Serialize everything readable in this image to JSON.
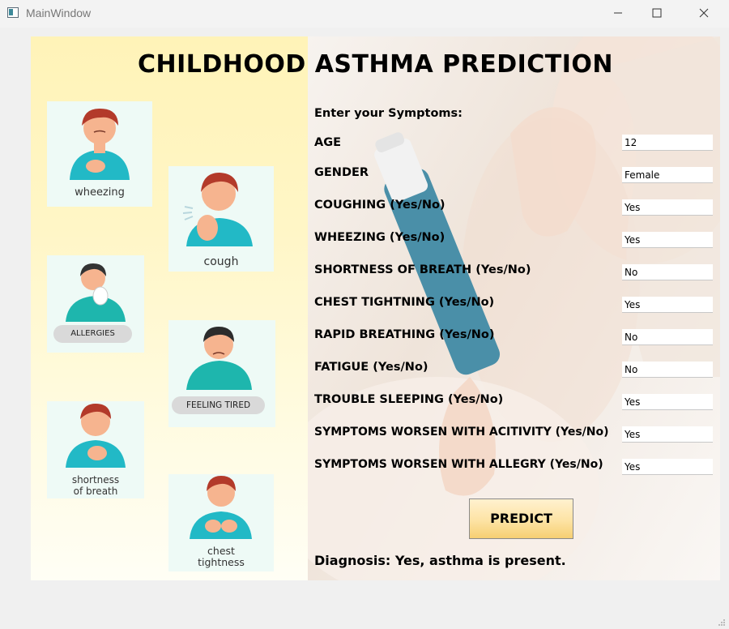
{
  "window": {
    "title": "MainWindow"
  },
  "app": {
    "title": "CHILDHOOD ASTHMA PREDICTION"
  },
  "illustrations": {
    "wheezing": "wheezing",
    "cough": "cough",
    "allergies": "ALLERGIES",
    "feeling_tired": "FEELING TIRED",
    "shortness_line1": "shortness",
    "shortness_line2": "of breath",
    "chest_line1": "chest",
    "chest_line2": "tightness"
  },
  "form": {
    "heading": "Enter your Symptoms:",
    "fields": [
      {
        "label": "AGE",
        "value": "12"
      },
      {
        "label": "GENDER",
        "value": "Female"
      },
      {
        "label": "COUGHING (Yes/No)",
        "value": "Yes"
      },
      {
        "label": "WHEEZING (Yes/No)",
        "value": "Yes"
      },
      {
        "label": "SHORTNESS OF BREATH (Yes/No)",
        "value": "No"
      },
      {
        "label": "CHEST TIGHTNING (Yes/No)",
        "value": "Yes"
      },
      {
        "label": "RAPID BREATHING (Yes/No)",
        "value": "No"
      },
      {
        "label": "FATIGUE (Yes/No)",
        "value": "No"
      },
      {
        "label": "TROUBLE SLEEPING (Yes/No)",
        "value": "Yes"
      },
      {
        "label": "SYMPTOMS WORSEN WITH ACITIVITY (Yes/No)",
        "value": "Yes"
      },
      {
        "label": "SYMPTOMS WORSEN WITH ALLEGRY (Yes/No)",
        "value": "Yes"
      }
    ],
    "predict_label": "PREDICT",
    "diagnosis": "Diagnosis: Yes, asthma is present."
  },
  "colors": {
    "accent_skin": "#f6b48f",
    "shirt": "#22b9c6",
    "hair": "#b33a2a",
    "inhaler": "#4a8fa8"
  }
}
